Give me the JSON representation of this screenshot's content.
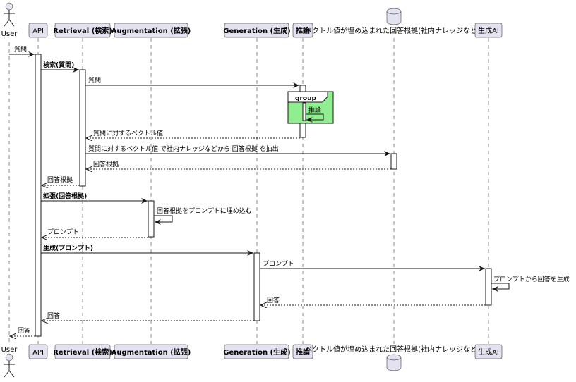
{
  "participants": {
    "user": "User",
    "api": "API",
    "retrieval": "Retrieval (検索)",
    "augmentation": "Augmentation (拡張)",
    "generation": "Generation (生成)",
    "inference": "推論",
    "database": "ベクトル値が埋め込まれた回答根拠(社内ナレッジなど)",
    "genai": "生成AI"
  },
  "messages": {
    "m1": "質問",
    "m2": "検索(質問)",
    "m3": "質問",
    "group_label": "group",
    "m4": "推論",
    "m5": "質問に対するベクトル値",
    "m6": "質問に対するベクトル値 で社内ナレッジなどから 回答根拠 を抽出",
    "m7": "回答根拠",
    "m8": "回答根拠",
    "m9": "拡張(回答根拠)",
    "m10": "回答根拠をプロンプトに埋め込む",
    "m11": "プロンプト",
    "m12": "生成(プロンプト)",
    "m13": "プロンプト",
    "m14": "プロンプトから回答を生成",
    "m15": "回答",
    "m16": "回答",
    "m17": "回答"
  },
  "colors": {
    "participant_fill": "#e2e2f0",
    "group_fill": "#90ee90",
    "line": "#181818"
  }
}
